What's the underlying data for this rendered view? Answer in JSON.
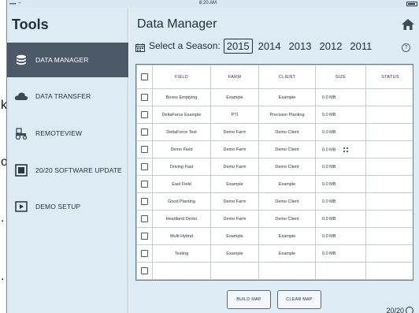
{
  "crop_strip": {
    "chars": [
      "k",
      "o",
      ".",
      "."
    ]
  },
  "status_bar": {
    "signal": "•••• ⌔",
    "time": "8:20 AM"
  },
  "sidebar": {
    "title": "Tools",
    "items": [
      {
        "label": "DATA MANAGER",
        "icon": "database-icon",
        "active": true
      },
      {
        "label": "DATA TRANSFER",
        "icon": "cloud-icon",
        "active": false
      },
      {
        "label": "REMOTEVIEW",
        "icon": "tractor-icon",
        "active": false
      },
      {
        "label": "20/20 SOFTWARE UPDATE",
        "icon": "software-update-icon",
        "active": false
      },
      {
        "label": "DEMO SETUP",
        "icon": "demo-setup-icon",
        "active": false
      }
    ]
  },
  "main": {
    "title": "Data Manager",
    "season_label": "Select a Season:",
    "years": [
      "2015",
      "2014",
      "2013",
      "2012",
      "2011"
    ],
    "selected_year": "2015",
    "help_glyph": "?"
  },
  "table": {
    "headers": [
      "",
      "FIELD",
      "FARM",
      "CLIENT",
      "SIZE",
      "STATUS"
    ],
    "rows": [
      {
        "field": "Boxes Emptying",
        "farm": "Example",
        "client": "Example",
        "size": "0.0 MB"
      },
      {
        "field": "DeltaForce Example",
        "farm": "PTI",
        "client": "Precision Planting",
        "size": "0.0 MB"
      },
      {
        "field": "DeltaForce Test",
        "farm": "Demo Farm",
        "client": "Demo Client",
        "size": "0.0 MB"
      },
      {
        "field": "Demo Field",
        "farm": "Demo Farm",
        "client": "Demo Client",
        "size": "0.0 MB",
        "has_icon": true
      },
      {
        "field": "Driving Fast",
        "farm": "Demo Farm",
        "client": "Demo Client",
        "size": "0.0 MB"
      },
      {
        "field": "East Field",
        "farm": "Example",
        "client": "Example",
        "size": "0.0 MB"
      },
      {
        "field": "Good Planting",
        "farm": "Demo Farm",
        "client": "Demo Client",
        "size": "0.0 MB"
      },
      {
        "field": "Headland Demo",
        "farm": "Demo Farm",
        "client": "Demo Client",
        "size": "0.0 MB"
      },
      {
        "field": "Multi Hybrid",
        "farm": "Example",
        "client": "Example",
        "size": "0.0 MB"
      },
      {
        "field": "Testing",
        "farm": "Example",
        "client": "Example",
        "size": "0.0 MB"
      }
    ]
  },
  "buttons": {
    "build_map": "BUILD MAP",
    "clear_map": "CLEAR MAP"
  },
  "brand": {
    "label": "20/20"
  },
  "colors": {
    "sidebar_active": "#4b5968",
    "panel_bg": "#dcebf4",
    "text": "#213040"
  }
}
